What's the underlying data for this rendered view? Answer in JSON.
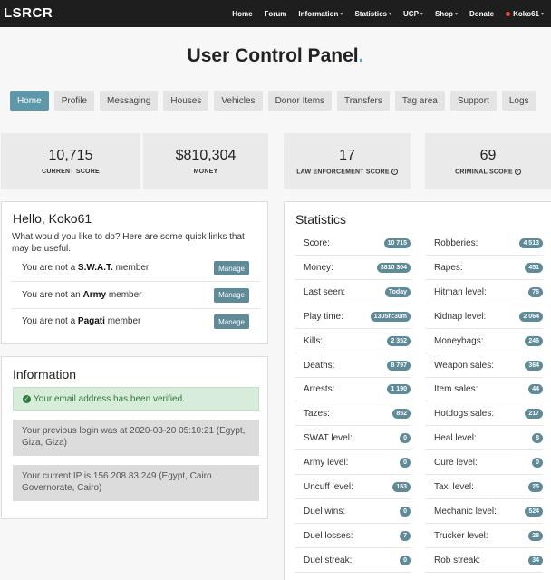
{
  "navbar": {
    "brand": "LSRCR",
    "items": [
      {
        "label": "Home",
        "caret": false
      },
      {
        "label": "Forum",
        "caret": false
      },
      {
        "label": "Information",
        "caret": true
      },
      {
        "label": "Statistics",
        "caret": true
      },
      {
        "label": "UCP",
        "caret": true
      },
      {
        "label": "Shop",
        "caret": true
      },
      {
        "label": "Donate",
        "caret": false
      }
    ],
    "user": "Koko61",
    "status_color": "#e74c3c"
  },
  "page_title": "User Control Panel",
  "page_title_dot": ".",
  "tabs": [
    "Home",
    "Profile",
    "Messaging",
    "Houses",
    "Vehicles",
    "Donor Items",
    "Transfers",
    "Tag area",
    "Support",
    "Logs"
  ],
  "active_tab": "Home",
  "stat_cards": [
    {
      "value": "10,715",
      "label": "CURRENT SCORE",
      "help": false
    },
    {
      "value": "$810,304",
      "label": "MONEY",
      "help": false
    },
    {
      "value": "17",
      "label": "LAW ENFORCEMENT SCORE",
      "help": true
    },
    {
      "value": "69",
      "label": "CRIMINAL SCORE",
      "help": true
    }
  ],
  "hello": {
    "title": "Hello, Koko61",
    "subtitle": "What would you like to do? Here are some quick links that may be useful.",
    "rows": [
      {
        "prefix": "You are not a ",
        "group": "S.W.A.T.",
        "suffix": " member",
        "button": "Manage"
      },
      {
        "prefix": "You are not an ",
        "group": "Army",
        "suffix": " member",
        "button": "Manage"
      },
      {
        "prefix": "You are not a ",
        "group": "Pagati",
        "suffix": " member",
        "button": "Manage"
      }
    ]
  },
  "information": {
    "title": "Information",
    "verified": "Your email address has been verified.",
    "last_login": "Your previous login was at 2020-03-20 05:10:21 (Egypt, Giza, Giza)",
    "current_ip": "Your current IP is 156.208.83.249 (Egypt, Cairo Governorate, Cairo)"
  },
  "statistics": {
    "title": "Statistics",
    "left": [
      {
        "label": "Score:",
        "value": "10 715"
      },
      {
        "label": "Money:",
        "value": "$810 304"
      },
      {
        "label": "Last seen:",
        "value": "Today"
      },
      {
        "label": "Play time:",
        "value": "1305h:30m"
      },
      {
        "label": "Kills:",
        "value": "2 352"
      },
      {
        "label": "Deaths:",
        "value": "8 797"
      },
      {
        "label": "Arrests:",
        "value": "1 190"
      },
      {
        "label": "Tazes:",
        "value": "852"
      },
      {
        "label": "SWAT level:",
        "value": "0"
      },
      {
        "label": "Army level:",
        "value": "0"
      },
      {
        "label": "Uncuff level:",
        "value": "163"
      },
      {
        "label": "Duel wins:",
        "value": "0"
      },
      {
        "label": "Duel losses:",
        "value": "7"
      },
      {
        "label": "Duel streak:",
        "value": "0"
      }
    ],
    "right": [
      {
        "label": "Robberies:",
        "value": "4 513"
      },
      {
        "label": "Rapes:",
        "value": "451"
      },
      {
        "label": "Hitman level:",
        "value": "76"
      },
      {
        "label": "Kidnap level:",
        "value": "2 064"
      },
      {
        "label": "Moneybags:",
        "value": "246"
      },
      {
        "label": "Weapon sales:",
        "value": "364"
      },
      {
        "label": "Item sales:",
        "value": "44"
      },
      {
        "label": "Hotdogs sales:",
        "value": "217"
      },
      {
        "label": "Heal level:",
        "value": "8"
      },
      {
        "label": "Cure level:",
        "value": "0"
      },
      {
        "label": "Taxi level:",
        "value": "25"
      },
      {
        "label": "Mechanic level:",
        "value": "524"
      },
      {
        "label": "Trucker level:",
        "value": "28"
      },
      {
        "label": "Rob streak:",
        "value": "34"
      }
    ]
  },
  "colors": {
    "accent": "#5d97a8",
    "button": "#5f8a98",
    "navbar": "#1e1e1e",
    "success_bg": "#d7ecdb"
  }
}
